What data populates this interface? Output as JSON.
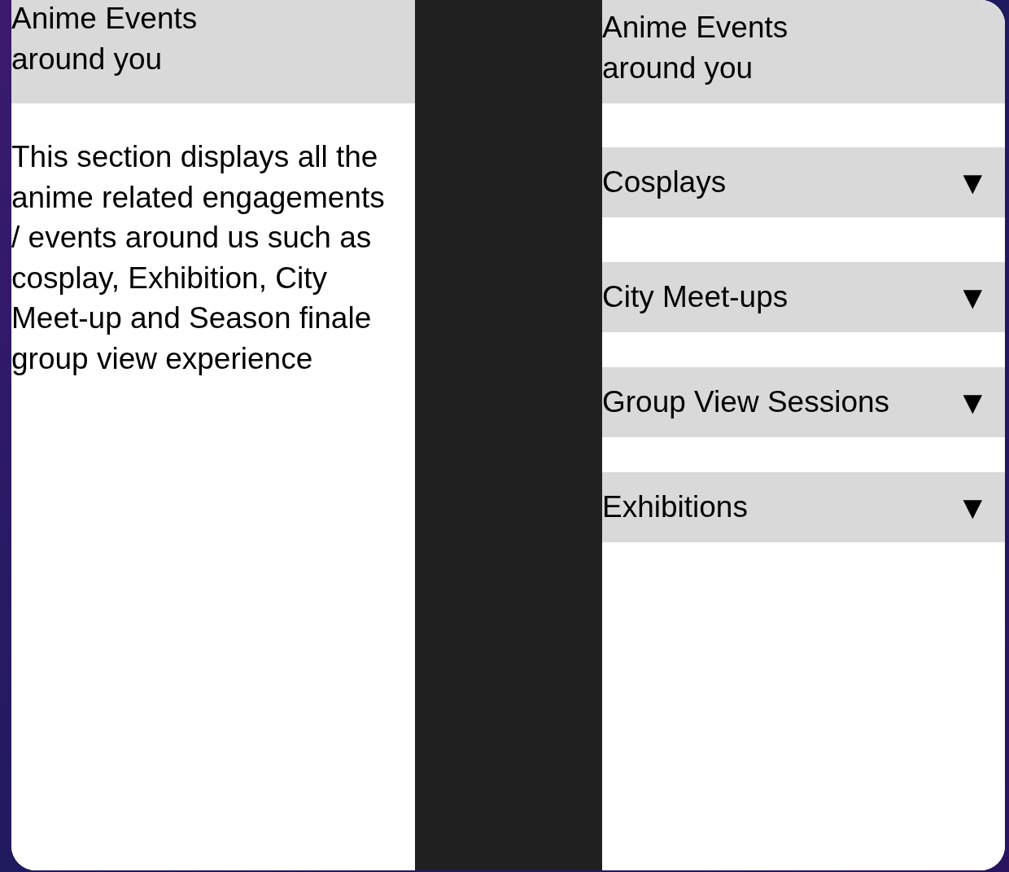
{
  "left_panel": {
    "title": "Anime Events\naround you",
    "description": "This section displays all the anime related engagements / events around us such as cosplay, Exhibition, City Meet-up and Season finale group view experience"
  },
  "right_panel": {
    "title": "Anime Events\naround you",
    "dropdowns": [
      {
        "label": "Cosplays",
        "icon": "▼"
      },
      {
        "label": "City Meet-ups",
        "icon": "▼"
      },
      {
        "label": "Group View Sessions",
        "icon": "▼"
      },
      {
        "label": "Exhibitions",
        "icon": "▼"
      }
    ]
  }
}
